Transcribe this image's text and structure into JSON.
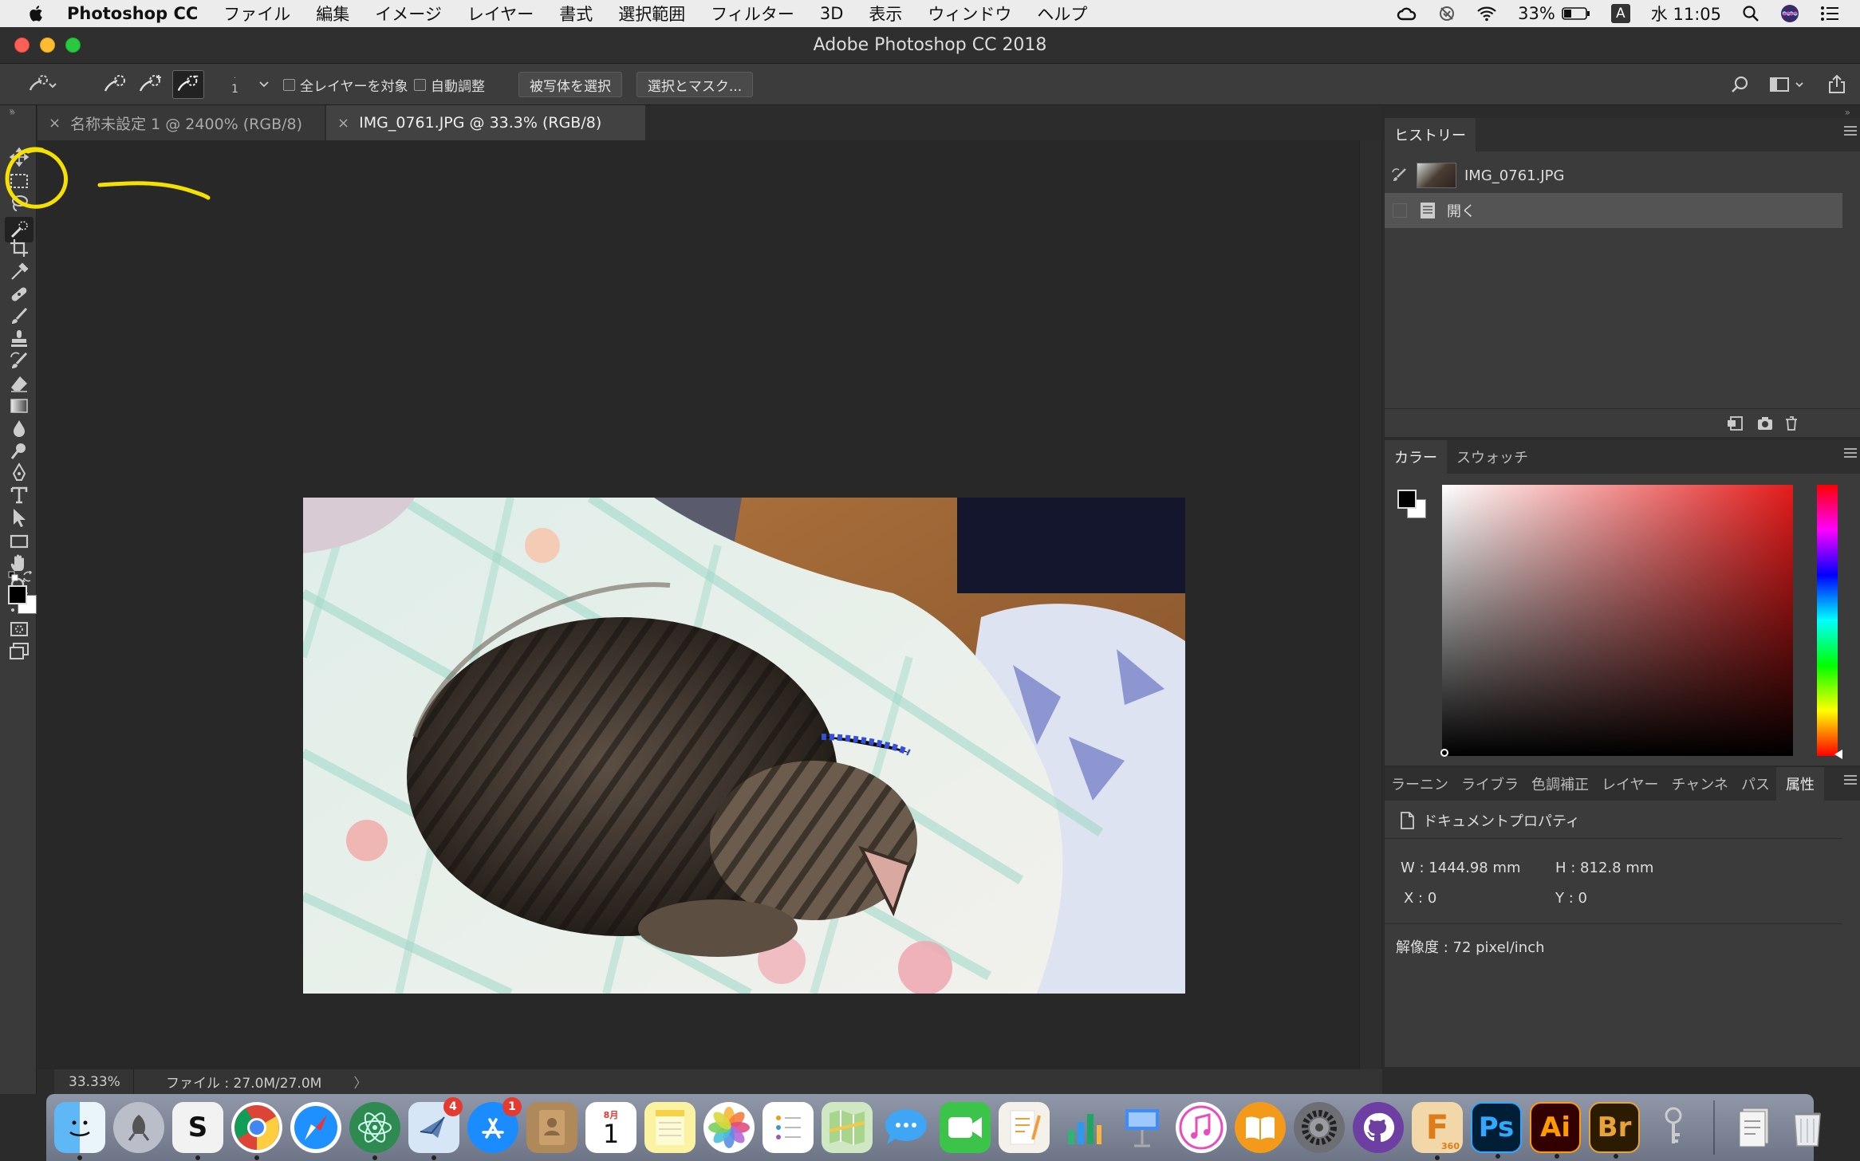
{
  "menubar": {
    "app_name": "Photoshop CC",
    "items": [
      "ファイル",
      "編集",
      "イメージ",
      "レイヤー",
      "書式",
      "選択範囲",
      "フィルター",
      "3D",
      "表示",
      "ウィンドウ",
      "ヘルプ"
    ],
    "battery": "33%",
    "ime": "A",
    "clock": "水 11:05"
  },
  "window": {
    "title": "Adobe Photoshop CC 2018"
  },
  "options_bar": {
    "brush_size": "1",
    "all_layers_label": "全レイヤーを対象",
    "auto_enhance_label": "自動調整",
    "select_subject_label": "被写体を選択",
    "select_mask_label": "選択とマスク..."
  },
  "tabs": [
    {
      "label": "名称未設定 1 @ 2400% (RGB/8)",
      "active": false,
      "close": "×"
    },
    {
      "label": "IMG_0761.JPG @ 33.3% (RGB/8)",
      "active": true,
      "close": "×"
    }
  ],
  "status_bar": {
    "zoom": "33.33%",
    "file_info": "ファイル : 27.0M/27.0M",
    "arrow": "〉"
  },
  "history_panel": {
    "tab": "ヒストリー",
    "snapshot": "IMG_0761.JPG",
    "states": [
      "開く"
    ]
  },
  "color_panel": {
    "tabs": [
      "カラー",
      "スウォッチ"
    ]
  },
  "properties_panel": {
    "tabs": [
      "ラーニン",
      "ライブラ",
      "色調補正",
      "レイヤー",
      "チャンネ",
      "パス",
      "属性"
    ],
    "title": "ドキュメントプロパティ",
    "w": "W : 1444.98 mm",
    "h": "H : 812.8 mm",
    "x": "X : 0",
    "y": "Y : 0",
    "resolution": "解像度 : 72 pixel/inch"
  },
  "dock": {
    "badges": {
      "mail": "4",
      "appstore": "1"
    },
    "calendar_month": "8月",
    "calendar_day": "1",
    "ps": "Ps",
    "ai": "Ai",
    "br": "Br",
    "f360": "F",
    "f360_sub": "360",
    "scrivener": "S"
  },
  "colors": {
    "accent_highlight": "#f5e000",
    "ps_blue": "#31a8ff",
    "ai_orange": "#ff9a00",
    "br_orange": "#e8a23a"
  }
}
